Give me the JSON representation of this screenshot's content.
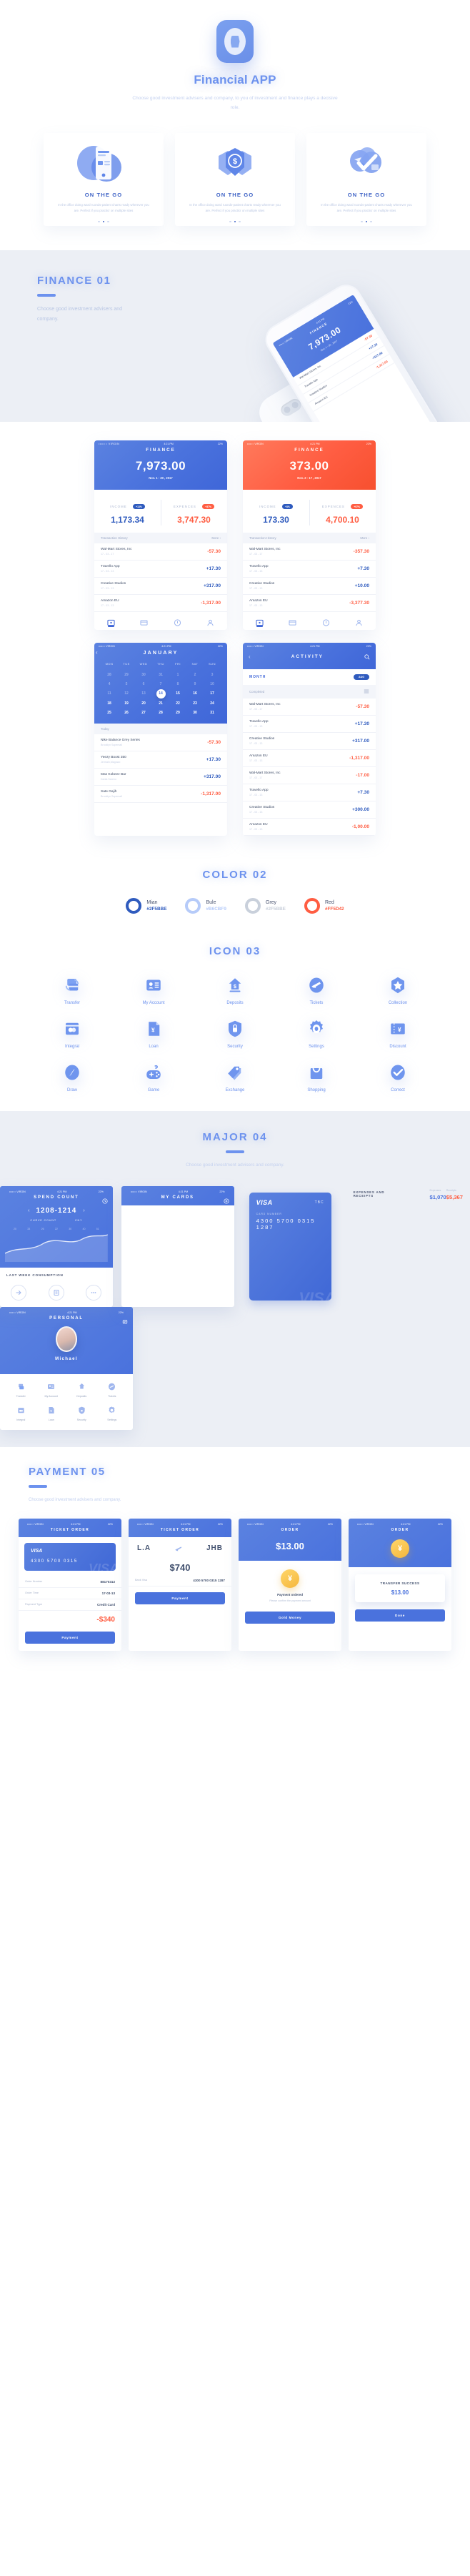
{
  "hero": {
    "title": "Financial APP",
    "subtitle": "Choose good investment advisers and company, to you of investment and finance plays a decisive role.",
    "logo_icon": "app-logo-icon"
  },
  "onboarding": {
    "cards": [
      {
        "title": "ON THE GO",
        "desc": "In the office doing ward ruonds-patient charts ready wherever you are. Perfect if you practicr on multiple sites",
        "art": "phone-illustration",
        "active_dot": 1
      },
      {
        "title": "ON THE GO",
        "desc": "In the office doing ward ruonds-patient charts ready wherever you are. Perfect if you practicr on multiple sites",
        "art": "shield-dollar-illustration",
        "active_dot": 1
      },
      {
        "title": "ON THE GO",
        "desc": "In the office doing ward ruonds-patient charts ready wherever you are. Perfect if you practicr on multiple sites",
        "art": "check-illustration",
        "active_dot": 1
      }
    ]
  },
  "finance_section": {
    "title": "FINANCE 01",
    "subtitle": "Choose good investment advisers and company.",
    "phone_preview": {
      "carrier": "••••○○ VIRGIN",
      "time": "4:21 PM",
      "battery": "22%",
      "screen_title": "FINANCE",
      "amount": "7,973.00",
      "date_range": "Nov. 1 - 30 , 2017",
      "rows": [
        {
          "name": "Wal-Mart Stores, Inc",
          "value": "-57.30"
        },
        {
          "name": "Travello App",
          "value": "+17.30"
        },
        {
          "name": "Creative Studios",
          "value": "+317.00"
        },
        {
          "name": "Amazon EU",
          "value": "-1,317.00"
        }
      ]
    }
  },
  "screens": {
    "status": {
      "carrier": "••••○○ VIRGIN",
      "time": "4:21 PM",
      "battery": "22%"
    },
    "finance_blue": {
      "title": "FINANCE",
      "amount": "7,973.00",
      "date_range": "Nov. 1 - 30 , 2017",
      "income_label": "INCOME",
      "income_badge": "+13%",
      "income_value": "1,173.34",
      "expences_label": "EXPENCES",
      "expences_badge": "+37%",
      "expences_value": "3,747.30",
      "history_label": "Transaction History",
      "more_label": "More ›",
      "transactions": [
        {
          "name": "Wal-Mart Stores, Inc",
          "date": "17 - 03 - 17",
          "value": "-57.30",
          "sign": "neg"
        },
        {
          "name": "Travello App",
          "date": "17 - 03 - 13",
          "value": "+17.30",
          "sign": "pos"
        },
        {
          "name": "Creative Studios",
          "date": "17 - 03 - 13",
          "value": "+317.00",
          "sign": "pos"
        },
        {
          "name": "Amazon EU",
          "date": "17 - 03 - 13",
          "value": "-1,317.00",
          "sign": "neg"
        }
      ],
      "tabs": [
        "wallet-icon",
        "card-icon",
        "info-icon",
        "profile-icon"
      ]
    },
    "finance_red": {
      "title": "FINANCE",
      "amount": "373.00",
      "date_range": "Nov. 2 - 17 , 2017",
      "income_label": "INCOME",
      "income_badge": "+3%",
      "income_value": "173.30",
      "expences_label": "EXPENCES",
      "expences_badge": "+97%",
      "expences_value": "4,700.10",
      "history_label": "Transaction History",
      "more_label": "More ›",
      "transactions": [
        {
          "name": "Wal-Mart Stores, Inc",
          "date": "17 - 03 - 17",
          "value": "-357.30",
          "sign": "neg"
        },
        {
          "name": "Travello App",
          "date": "17 - 03 - 13",
          "value": "+7.30",
          "sign": "pos"
        },
        {
          "name": "Creative Studios",
          "date": "17 - 03 - 13",
          "value": "+10.00",
          "sign": "pos"
        },
        {
          "name": "Amazon EU",
          "date": "17 - 03 - 13",
          "value": "-3,377.30",
          "sign": "neg"
        }
      ],
      "tabs": [
        "wallet-icon",
        "card-icon",
        "info-icon",
        "profile-icon"
      ]
    },
    "calendar": {
      "title": "JANUARY",
      "back_icon": "chevron-left-icon",
      "dow": [
        "MON",
        "TUE",
        "WED",
        "THU",
        "FRI",
        "SAT",
        "SUN"
      ],
      "weeks": [
        [
          {
            "d": "28",
            "dim": true
          },
          {
            "d": "29",
            "dim": true
          },
          {
            "d": "30",
            "dim": true
          },
          {
            "d": "31",
            "dim": true
          },
          {
            "d": "1",
            "dim": true
          },
          {
            "d": "2",
            "dim": true
          },
          {
            "d": "3",
            "dim": true
          }
        ],
        [
          {
            "d": "4",
            "dim": true
          },
          {
            "d": "5",
            "dim": true
          },
          {
            "d": "6",
            "dim": true
          },
          {
            "d": "7",
            "dim": true
          },
          {
            "d": "8",
            "dim": true
          },
          {
            "d": "9",
            "dim": true
          },
          {
            "d": "10",
            "dim": true
          }
        ],
        [
          {
            "d": "11",
            "dim": true
          },
          {
            "d": "12",
            "dim": true
          },
          {
            "d": "13",
            "dim": true
          },
          {
            "d": "14",
            "sel": true
          },
          {
            "d": "15"
          },
          {
            "d": "16"
          },
          {
            "d": "17"
          }
        ],
        [
          {
            "d": "18"
          },
          {
            "d": "19"
          },
          {
            "d": "20"
          },
          {
            "d": "21"
          },
          {
            "d": "22"
          },
          {
            "d": "23"
          },
          {
            "d": "24"
          }
        ],
        [
          {
            "d": "25"
          },
          {
            "d": "26"
          },
          {
            "d": "27"
          },
          {
            "d": "28"
          },
          {
            "d": "29"
          },
          {
            "d": "30"
          },
          {
            "d": "31"
          }
        ]
      ],
      "today_label": "Today",
      "items": [
        {
          "name": "Nike Balance Grey Series",
          "place": "Brooklyn Supemall",
          "value": "-57.30",
          "sign": "neg"
        },
        {
          "name": "Yeezy Boost 350",
          "place": "Jermain,Maguwo",
          "value": "+17.30",
          "sign": "pos"
        },
        {
          "name": "Mas Kobeez Bar",
          "place": "Danla Sareno",
          "value": "+317.00",
          "sign": "pos"
        },
        {
          "name": "Sate Gajih",
          "place": "Brooklyn Supemall",
          "value": "-1,317.00",
          "sign": "neg"
        }
      ]
    },
    "activity": {
      "title": "ACTIVITY",
      "back_icon": "chevron-left-icon",
      "search_icon": "search-icon",
      "month_label": "MONTH",
      "month_badge": "AUG",
      "completed_label": "Completed",
      "filter_icon": "filter-icon",
      "items": [
        {
          "name": "Wal-Mart Stores, Inc",
          "date": "17 - 03 - 17",
          "value": "-57.30",
          "sign": "neg"
        },
        {
          "name": "Travello App",
          "date": "17 - 03 - 13",
          "value": "+17.30",
          "sign": "pos"
        },
        {
          "name": "Creative Studios",
          "date": "17 - 03 - 13",
          "value": "+317.00",
          "sign": "pos"
        },
        {
          "name": "Amazon EU",
          "date": "17 - 03 - 13",
          "value": "-1,317.00",
          "sign": "neg"
        },
        {
          "name": "Wal-Mart Stores, Inc",
          "date": "17 - 03 - 17",
          "value": "-17.00",
          "sign": "neg"
        },
        {
          "name": "Travello App",
          "date": "17 - 03 - 13",
          "value": "+7.30",
          "sign": "pos"
        },
        {
          "name": "Creative Studios",
          "date": "17 - 03 - 13",
          "value": "+300.00",
          "sign": "pos"
        },
        {
          "name": "Amazon EU",
          "date": "17 - 03 - 13",
          "value": "-1,00.00",
          "sign": "neg"
        }
      ]
    }
  },
  "color_section": {
    "title": "COLOR 02",
    "swatches": [
      {
        "name": "Mian",
        "hex": "#2F5BBE",
        "ring": "#2F5BBE",
        "text": "#2F5BBE"
      },
      {
        "name": "Bule",
        "hex": "#B6CBF9",
        "ring": "#B6CBF9",
        "text": "#B6CBF9"
      },
      {
        "name": "Grey",
        "hex": "#2F5BBE",
        "ring": "#C9D0DB",
        "text": "#C9D0DB"
      },
      {
        "name": "Red",
        "hex": "#FF5D42",
        "ring": "#FF5D42",
        "text": "#FF5D42"
      }
    ]
  },
  "icon_section": {
    "title": "ICON  03",
    "icons": [
      {
        "label": "Transfer",
        "icon": "transfer-icon"
      },
      {
        "label": "My Account",
        "icon": "my-account-icon"
      },
      {
        "label": "Deposits",
        "icon": "deposits-icon"
      },
      {
        "label": "Tickets",
        "icon": "tickets-icon"
      },
      {
        "label": "Collection",
        "icon": "collection-icon"
      },
      {
        "label": "Integral",
        "icon": "integral-icon"
      },
      {
        "label": "Loan",
        "icon": "loan-icon"
      },
      {
        "label": "Security",
        "icon": "security-icon"
      },
      {
        "label": "Settings",
        "icon": "settings-icon"
      },
      {
        "label": "Discount",
        "icon": "discount-icon"
      },
      {
        "label": "Draw",
        "icon": "draw-icon"
      },
      {
        "label": "Game",
        "icon": "game-icon"
      },
      {
        "label": "Exchange",
        "icon": "exchange-icon"
      },
      {
        "label": "Shopping",
        "icon": "shopping-icon"
      },
      {
        "label": "Correct",
        "icon": "correct-icon"
      }
    ]
  },
  "major_section": {
    "title": "MAJOR 04",
    "subtitle": "Choose good investment advisers and company.",
    "spend": {
      "title": "SPEND COUNT",
      "header_icon": "clock-icon",
      "range": "1208-1214",
      "prev_icon": "chevron-left-icon",
      "next_icon": "chevron-right-icon",
      "sub_left": "CURVE COUNT",
      "sub_right": "CNY",
      "axis": [
        "20",
        "33",
        "26",
        "22",
        "30",
        "40",
        "51"
      ],
      "last_week_label": "LAST WEEK CONSUMPTION",
      "actions": [
        "pay-icon",
        "bill-icon",
        "more-icon"
      ]
    },
    "cards": {
      "title": "MY CARDS",
      "header_icon": "add-icon",
      "card_brand": "VISA",
      "card_tbc": "TBC",
      "card_number_label": "CARD NUMBER",
      "card_number": "4300  5700  0315  1287",
      "section_title": "EXPENSES AND RECEIPTS",
      "expense_label": "Expenses",
      "expense_value": "$1,070",
      "receipt_label": "Receipts",
      "receipt_value": "$5,367"
    },
    "personal": {
      "title": "PERSONAL",
      "header_icon": "message-icon",
      "avatar": "user-avatar",
      "name": "Michael",
      "grid": [
        {
          "label": "Transfer",
          "icon": "transfer-icon"
        },
        {
          "label": "My Account",
          "icon": "my-account-icon"
        },
        {
          "label": "Deposits",
          "icon": "deposits-icon"
        },
        {
          "label": "Tickets",
          "icon": "tickets-icon"
        },
        {
          "label": "Integral",
          "icon": "integral-icon"
        },
        {
          "label": "Loan",
          "icon": "loan-icon"
        },
        {
          "label": "Security",
          "icon": "security-icon"
        },
        {
          "label": "Settings",
          "icon": "settings-icon"
        }
      ]
    }
  },
  "payment_section": {
    "title": "PAYMENT 05",
    "subtitle": "Choose good investment advisers and company.",
    "screens": [
      {
        "title": "TICKET ORDER",
        "card_brand": "VISA",
        "card_number": "4300 5700 0315",
        "rows": [
          {
            "k": "Order Number",
            "v": "88170313"
          },
          {
            "k": "Order Time",
            "v": "17-03-13"
          },
          {
            "k": "Payment Type",
            "v": "Credit Card"
          }
        ],
        "total": "-$340",
        "button": "Payment"
      },
      {
        "title": "TICKET ORDER",
        "from": "L.A",
        "to": "JHB",
        "plane_icon": "plane-icon",
        "total": "$740",
        "rows": [
          {
            "k": "Bank Visa",
            "v": "4300 5700 0315 1287"
          }
        ],
        "button": "Payment"
      },
      {
        "title": "ORDER",
        "amount": "$13.00",
        "coin_icon": "coin-icon",
        "note": "Payment ordered",
        "sub": "Please confirm the payment amount",
        "button": "Gold Money"
      },
      {
        "title": "ORDER",
        "modal_title": "TRANSFER SUCCESS",
        "modal_value": "$13.00",
        "coin_icon": "coin-icon",
        "button": "Done"
      }
    ]
  }
}
